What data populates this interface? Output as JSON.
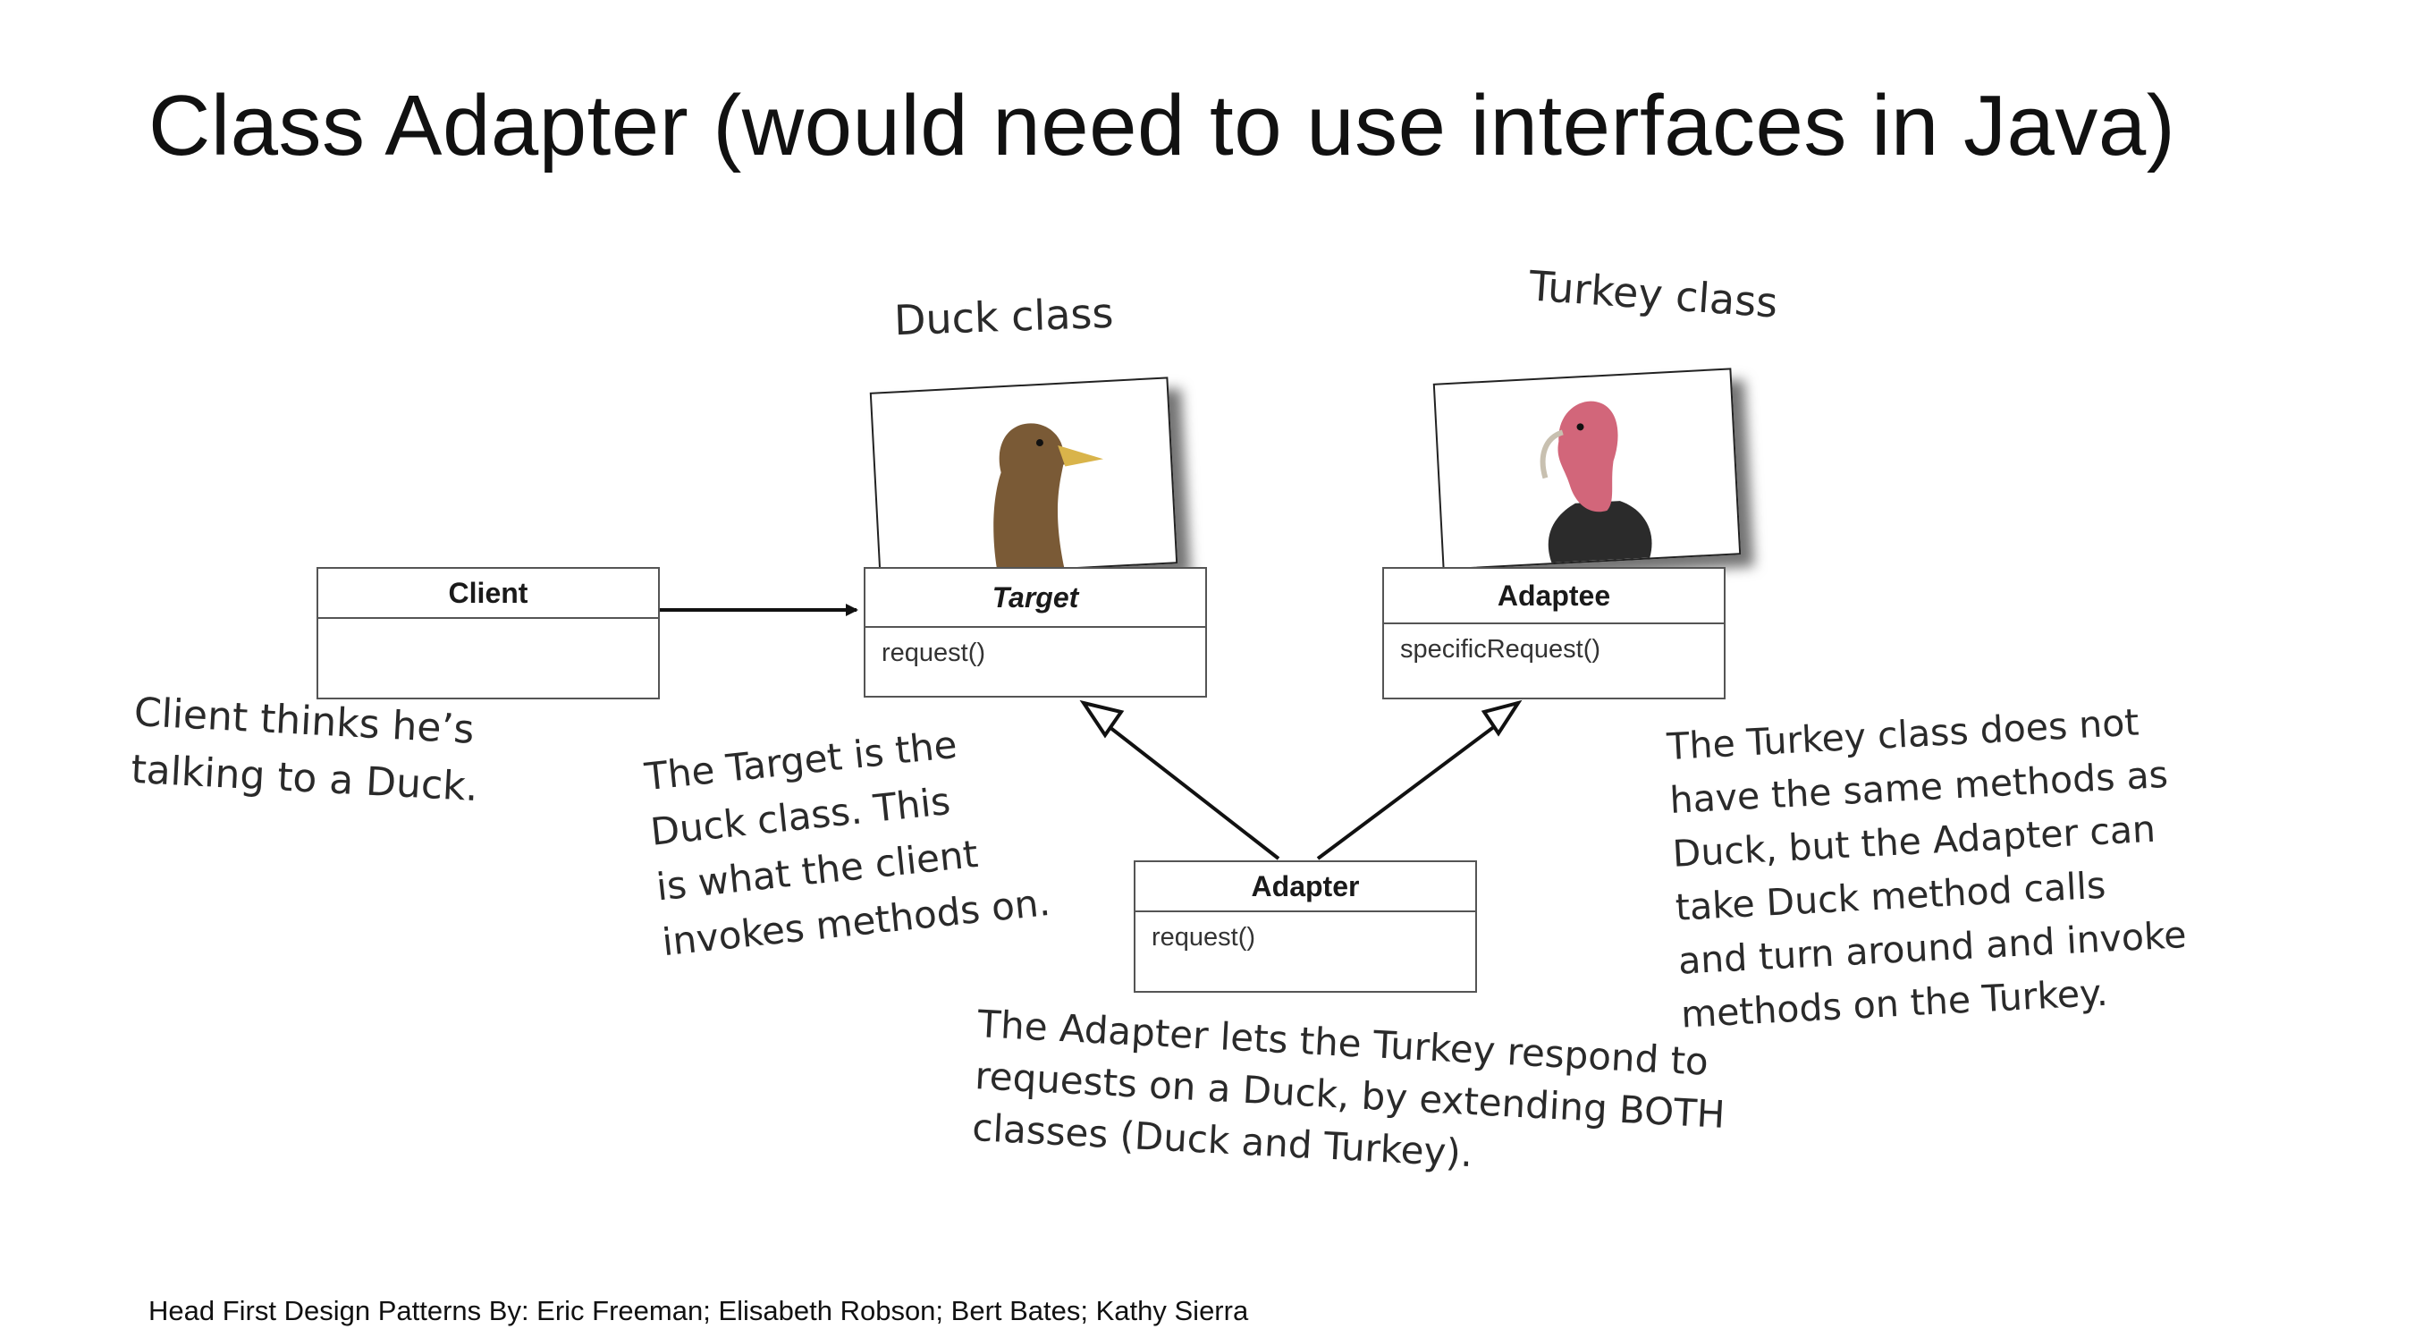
{
  "title": "Class Adapter (would need to use interfaces in Java)",
  "tags": {
    "duck": "Duck class",
    "turkey": "Turkey class"
  },
  "classes": {
    "client": {
      "name": "Client",
      "method": ""
    },
    "target": {
      "name": "Target",
      "method": "request()"
    },
    "adaptee": {
      "name": "Adaptee",
      "method": "specificRequest()"
    },
    "adapter": {
      "name": "Adapter",
      "method": "request()"
    }
  },
  "notes": {
    "client": [
      "Client thinks he’s",
      "talking to a Duck."
    ],
    "target": [
      "The Target is the",
      "Duck class. This",
      "is what the client",
      "invokes methods on."
    ],
    "turkey": [
      "The Turkey class does not",
      "have the same methods as",
      "Duck, but the Adapter can",
      "take Duck method calls",
      "and turn around and invoke",
      "methods on the Turkey."
    ],
    "adapter": [
      "The Adapter lets the Turkey respond to",
      "requests on a Duck, by extending BOTH",
      "classes (Duck and Turkey)."
    ]
  },
  "citation": "Head First Design Patterns By: Eric Freeman; Elisabeth Robson; Bert Bates; Kathy Sierra",
  "colors": {
    "duck_head": "#7a5a36",
    "duck_bill": "#d9b44a",
    "turkey_head": "#d2667a",
    "turkey_body": "#2b2b2b"
  }
}
